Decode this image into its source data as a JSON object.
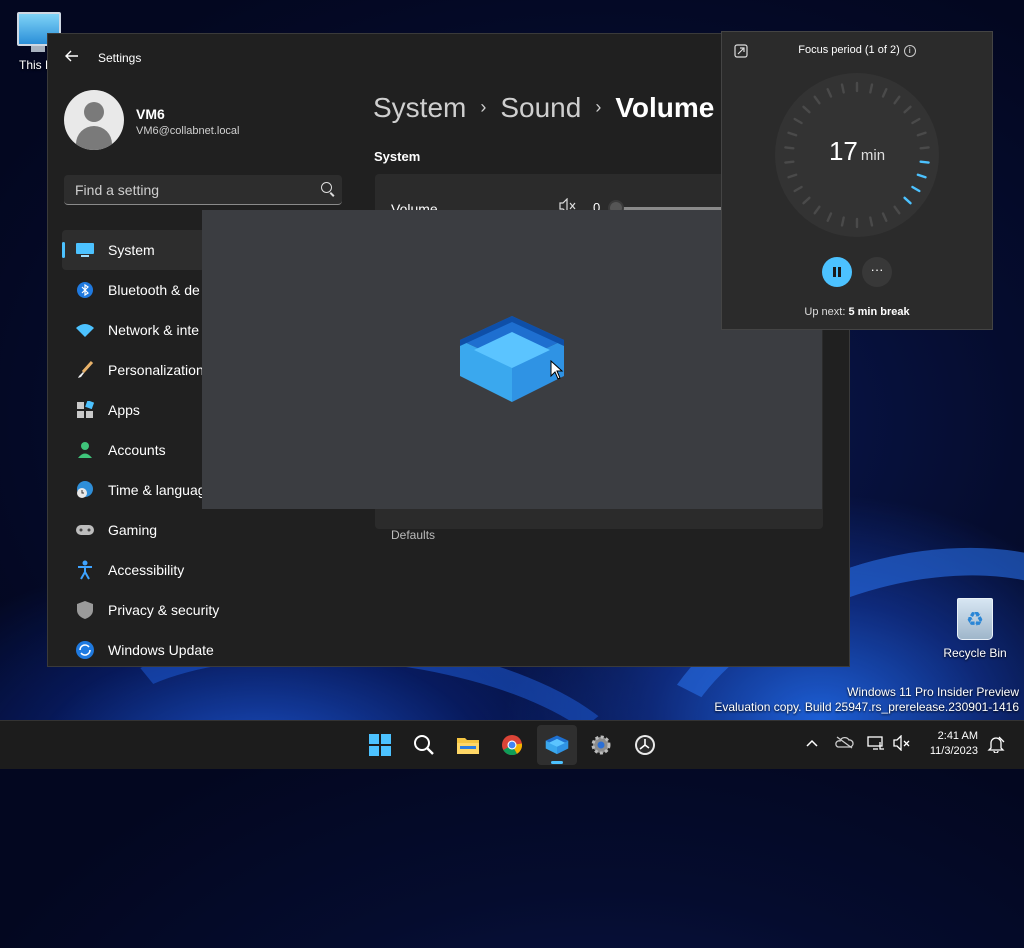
{
  "desktop": {
    "this_pc_label": "This P",
    "recycle_bin_label": "Recycle Bin",
    "watermark_line1": "Windows 11 Pro Insider Preview",
    "watermark_line2": "Evaluation copy. Build 25947.rs_prerelease.230901-1416"
  },
  "settings": {
    "window_title": "Settings",
    "user": {
      "name": "VM6",
      "email": "VM6@collabnet.local"
    },
    "search": {
      "placeholder": "Find a setting"
    },
    "nav": [
      {
        "label": "System",
        "icon": "system-icon",
        "active": true
      },
      {
        "label": "Bluetooth & de",
        "icon": "bluetooth-icon"
      },
      {
        "label": "Network & inte",
        "icon": "network-icon"
      },
      {
        "label": "Personalization",
        "icon": "brush-icon"
      },
      {
        "label": "Apps",
        "icon": "apps-icon"
      },
      {
        "label": "Accounts",
        "icon": "accounts-icon"
      },
      {
        "label": "Time & languag",
        "icon": "time-language-icon"
      },
      {
        "label": "Gaming",
        "icon": "gamepad-icon"
      },
      {
        "label": "Accessibility",
        "icon": "accessibility-icon"
      },
      {
        "label": "Privacy & security",
        "icon": "shield-icon"
      },
      {
        "label": "Windows Update",
        "icon": "update-icon"
      }
    ],
    "breadcrumb": {
      "part1": "System",
      "part2": "Sound",
      "current": "Volume"
    },
    "section_heading": "System",
    "volume_row": {
      "label": "Volume",
      "value": "0"
    },
    "partially_hidden_label": "Defaults"
  },
  "focus": {
    "title": "Focus period (1 of 2)",
    "minutes": "17",
    "unit": "min",
    "up_next_prefix": "Up next:",
    "up_next_value": "5 min break",
    "progress_fraction": 0.15
  },
  "taskbar": {
    "apps": [
      "start-icon",
      "search-icon",
      "file-explorer-icon",
      "chrome-icon",
      "dev-home-icon",
      "settings-icon",
      "clock-app-icon"
    ],
    "time": "2:41 AM",
    "date": "11/3/2023"
  },
  "colors": {
    "accent": "#4cc2ff",
    "settings_bg": "#202020",
    "card_bg": "#2b2b2b",
    "splash_bg": "#3b3d41"
  }
}
